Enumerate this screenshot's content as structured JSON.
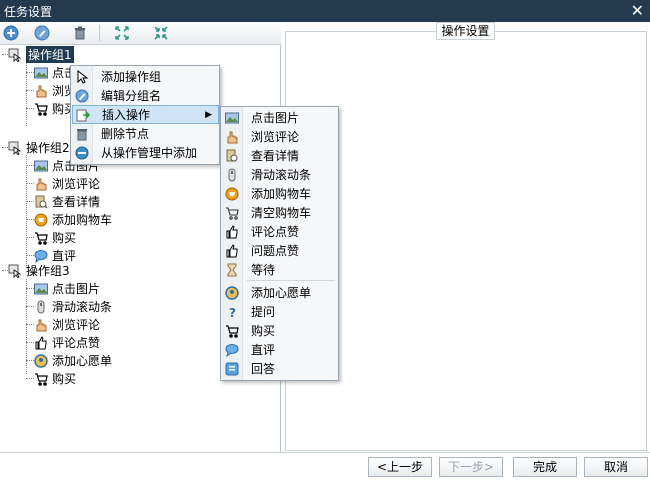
{
  "window": {
    "title": "任务设置",
    "close_glyph": "✕"
  },
  "toolbar": {
    "buttons": [
      {
        "icon": "add-circle-icon"
      },
      {
        "icon": "edit-circle-icon"
      },
      {
        "icon": "trash-icon"
      },
      {
        "icon": "expand-icon"
      },
      {
        "icon": "collapse-icon"
      }
    ]
  },
  "right_panel": {
    "title": "操作设置"
  },
  "tree": {
    "groups": [
      {
        "label": "操作组1",
        "selected": true,
        "items": [
          "点击图片",
          "浏览评论",
          "购买"
        ]
      },
      {
        "label": "操作组2",
        "items": [
          "点击图片",
          "浏览评论",
          "查看详情",
          "添加购物车",
          "购买",
          "直评"
        ]
      },
      {
        "label": "操作组3",
        "items": [
          "点击图片",
          "滑动滚动条",
          "浏览评论",
          "评论点赞",
          "添加心愿单",
          "购买"
        ]
      }
    ]
  },
  "context_menu": {
    "items": [
      {
        "label": "添加操作组",
        "icon": "cursor-icon"
      },
      {
        "label": "编辑分组名",
        "icon": "edit-circle-icon"
      },
      {
        "label": "插入操作",
        "icon": "insert-icon",
        "highlighted": true,
        "has_submenu": true
      },
      {
        "label": "删除节点",
        "icon": "trash-icon"
      },
      {
        "label": "从操作管理中添加",
        "icon": "manage-icon"
      }
    ]
  },
  "submenu": {
    "items": [
      {
        "label": "点击图片",
        "icon": "image-icon"
      },
      {
        "label": "浏览评论",
        "icon": "hand-icon"
      },
      {
        "label": "查看详情",
        "icon": "detail-icon"
      },
      {
        "label": "滑动滚动条",
        "icon": "scroll-icon"
      },
      {
        "label": "添加购物车",
        "icon": "cart-add-icon"
      },
      {
        "label": "清空购物车",
        "icon": "cart-empty-icon"
      },
      {
        "label": "评论点赞",
        "icon": "thumbs-up-icon"
      },
      {
        "label": "问题点赞",
        "icon": "thumbs-up-icon"
      },
      {
        "label": "等待",
        "icon": "hourglass-icon"
      },
      {
        "label": "添加心愿单",
        "icon": "wishlist-icon"
      },
      {
        "label": "提问",
        "icon": "question-icon"
      },
      {
        "label": "购买",
        "icon": "cart-buy-icon"
      },
      {
        "label": "直评",
        "icon": "comment-icon"
      },
      {
        "label": "回答",
        "icon": "answer-icon"
      }
    ]
  },
  "footer": {
    "prev_label": "<上一步",
    "next_label": "下一步>",
    "finish_label": "完成",
    "cancel_label": "取消"
  },
  "colors": {
    "titlebar": "#243a4f",
    "selection": "#1f3a52",
    "menu_highlight": "#cfe4f7"
  }
}
